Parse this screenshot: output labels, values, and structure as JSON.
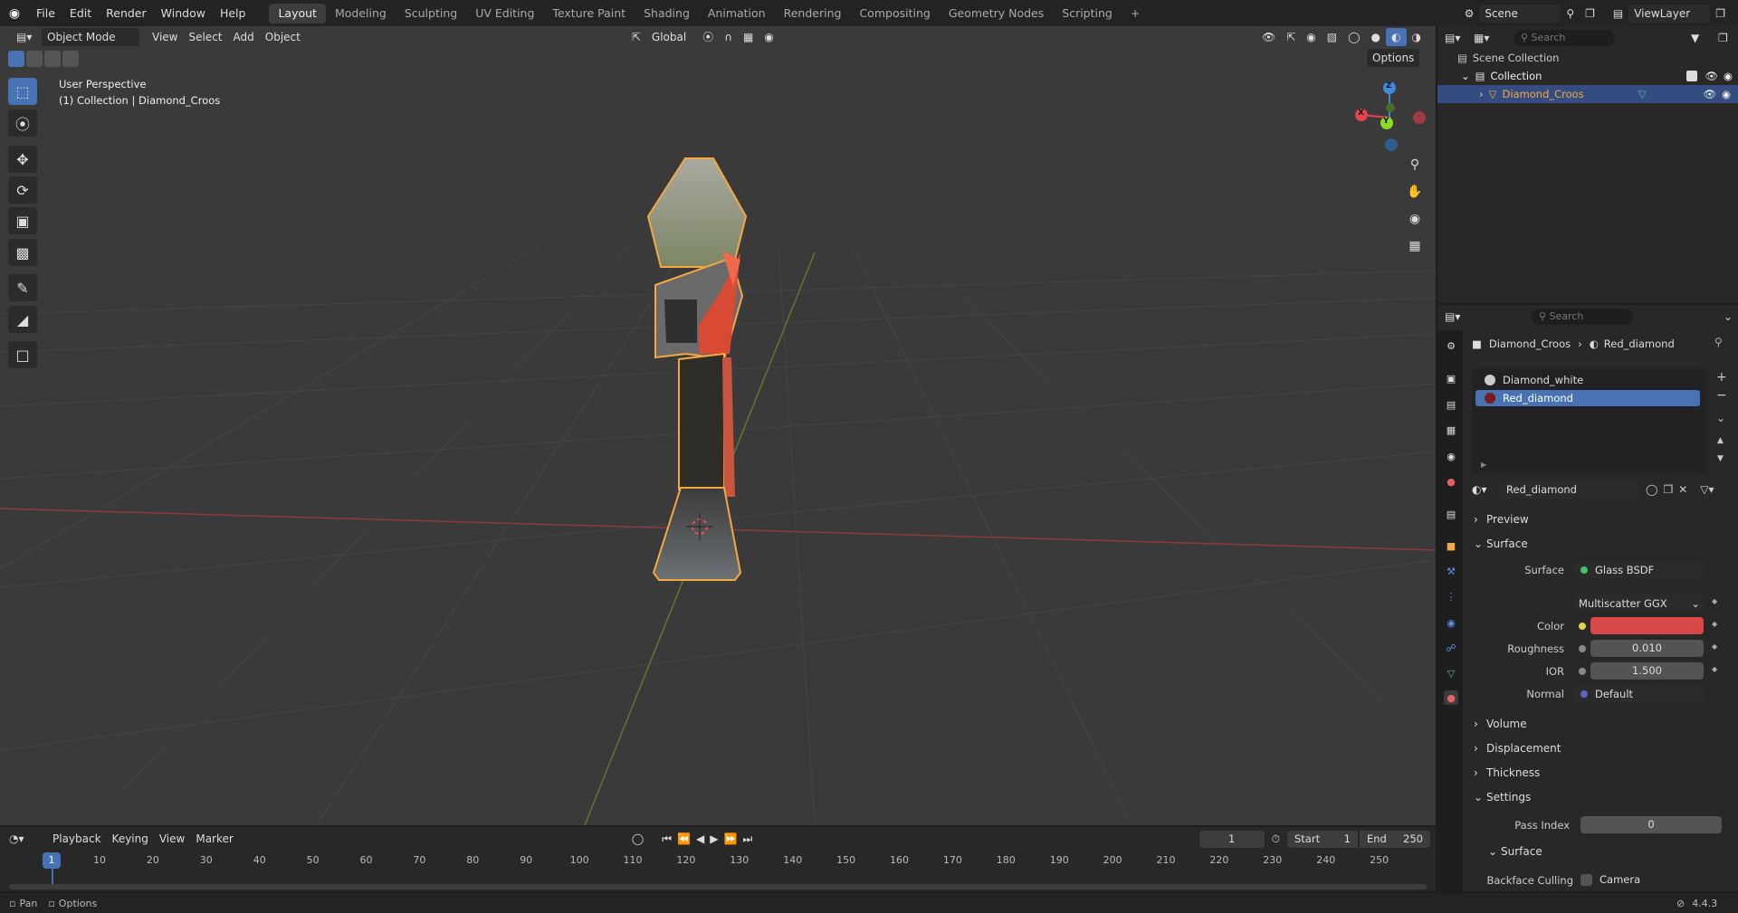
{
  "menus": [
    "File",
    "Edit",
    "Render",
    "Window",
    "Help"
  ],
  "workspaces": [
    "Layout",
    "Modeling",
    "Sculpting",
    "UV Editing",
    "Texture Paint",
    "Shading",
    "Animation",
    "Rendering",
    "Compositing",
    "Geometry Nodes",
    "Scripting",
    "+"
  ],
  "scene": {
    "label": "Scene",
    "viewlayer": "ViewLayer"
  },
  "viewport": {
    "mode": "Object Mode",
    "menu": [
      "View",
      "Select",
      "Add",
      "Object"
    ],
    "orientation": "Global",
    "options": "Options",
    "overlay_title": "User Perspective",
    "overlay_sub": "(1) Collection | Diamond_Croos",
    "gizmo": {
      "x": "X",
      "y": "Y",
      "z": "Z"
    }
  },
  "outliner": {
    "search": "Search",
    "scene_collection": "Scene Collection",
    "collection": "Collection",
    "object": "Diamond_Croos"
  },
  "properties": {
    "search": "Search",
    "breadcrumb_obj": "Diamond_Croos",
    "breadcrumb_mat": "Red_diamond",
    "slots": [
      "Diamond_white",
      "Red_diamond"
    ],
    "material_name": "Red_diamond",
    "panels": {
      "preview": "Preview",
      "surface": "Surface",
      "volume": "Volume",
      "displacement": "Displacement",
      "thickness": "Thickness",
      "settings": "Settings",
      "surface_sub": "Surface"
    },
    "surface_label": "Surface",
    "surface_value": "Glass BSDF",
    "distribution": "Multiscatter GGX",
    "color_label": "Color",
    "color_hex": "#d94848",
    "roughness_label": "Roughness",
    "roughness": "0.010",
    "ior_label": "IOR",
    "ior": "1.500",
    "normal_label": "Normal",
    "normal": "Default",
    "pass_index_label": "Pass Index",
    "pass_index": "0",
    "backface_label": "Backface Culling",
    "backface_camera": "Camera"
  },
  "timeline": {
    "menus": [
      "Playback",
      "Keying",
      "View",
      "Marker"
    ],
    "current": "1",
    "start_label": "Start",
    "start": "1",
    "end_label": "End",
    "end": "250",
    "frame_marker": "1",
    "ticks": [
      "10",
      "20",
      "30",
      "40",
      "50",
      "60",
      "70",
      "80",
      "90",
      "100",
      "110",
      "120",
      "130",
      "140",
      "150",
      "160",
      "170",
      "180",
      "190",
      "200",
      "210",
      "220",
      "230",
      "240",
      "250"
    ]
  },
  "status": {
    "pan": "Pan",
    "options": "Options",
    "version": "4.4.3"
  },
  "colors": {
    "accent": "#4772b3",
    "selection": "#f5a742",
    "x_axis": "#e8414f",
    "y_axis": "#8bdb22",
    "z_axis": "#3d8ae0"
  }
}
